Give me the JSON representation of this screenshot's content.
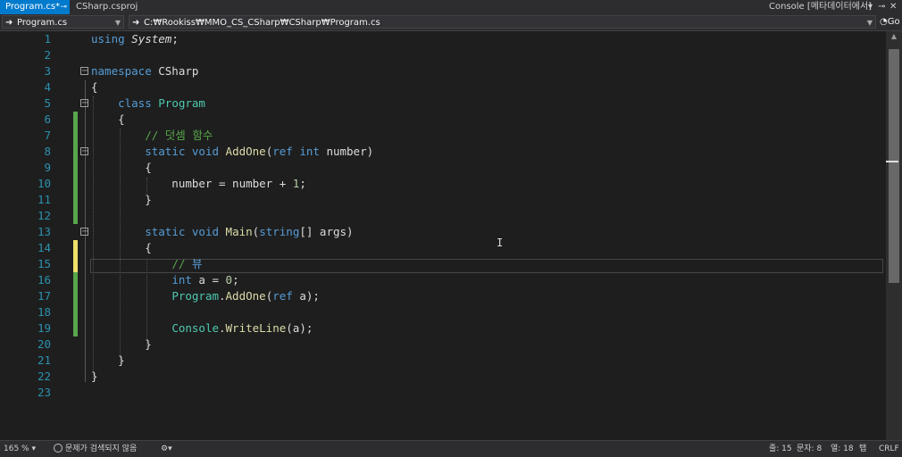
{
  "tabs": {
    "active": {
      "label": "Program.cs*",
      "pin": "⊸"
    },
    "inactive": {
      "label": "CSharp.csproj"
    },
    "right": {
      "label": "Console [메타데이터에서]"
    }
  },
  "navbar": {
    "scope": "Program.cs",
    "path": "C:₩Rookiss₩MMO_CS_CSharp₩CSharp₩Program.cs",
    "go": "Go"
  },
  "editor": {
    "line_numbers": [
      "1",
      "2",
      "3",
      "4",
      "5",
      "6",
      "7",
      "8",
      "9",
      "10",
      "11",
      "12",
      "13",
      "14",
      "15",
      "16",
      "17",
      "18",
      "19",
      "20",
      "21",
      "22",
      "23"
    ],
    "current_line": 15
  },
  "statusbar": {
    "zoom": "165 %",
    "issues": "문제가 검색되지 않음",
    "line": "줄: 15",
    "char": "문자: 8",
    "col": "열: 18",
    "tab": "탭",
    "eol": "CRLF"
  },
  "colors": {
    "keyword": "#569cd6",
    "class": "#4ec9b0",
    "method": "#dcdcaa",
    "comment": "#57a64a",
    "number": "#b5cea8",
    "line_number": "#2b91af",
    "accent": "#007acc"
  }
}
